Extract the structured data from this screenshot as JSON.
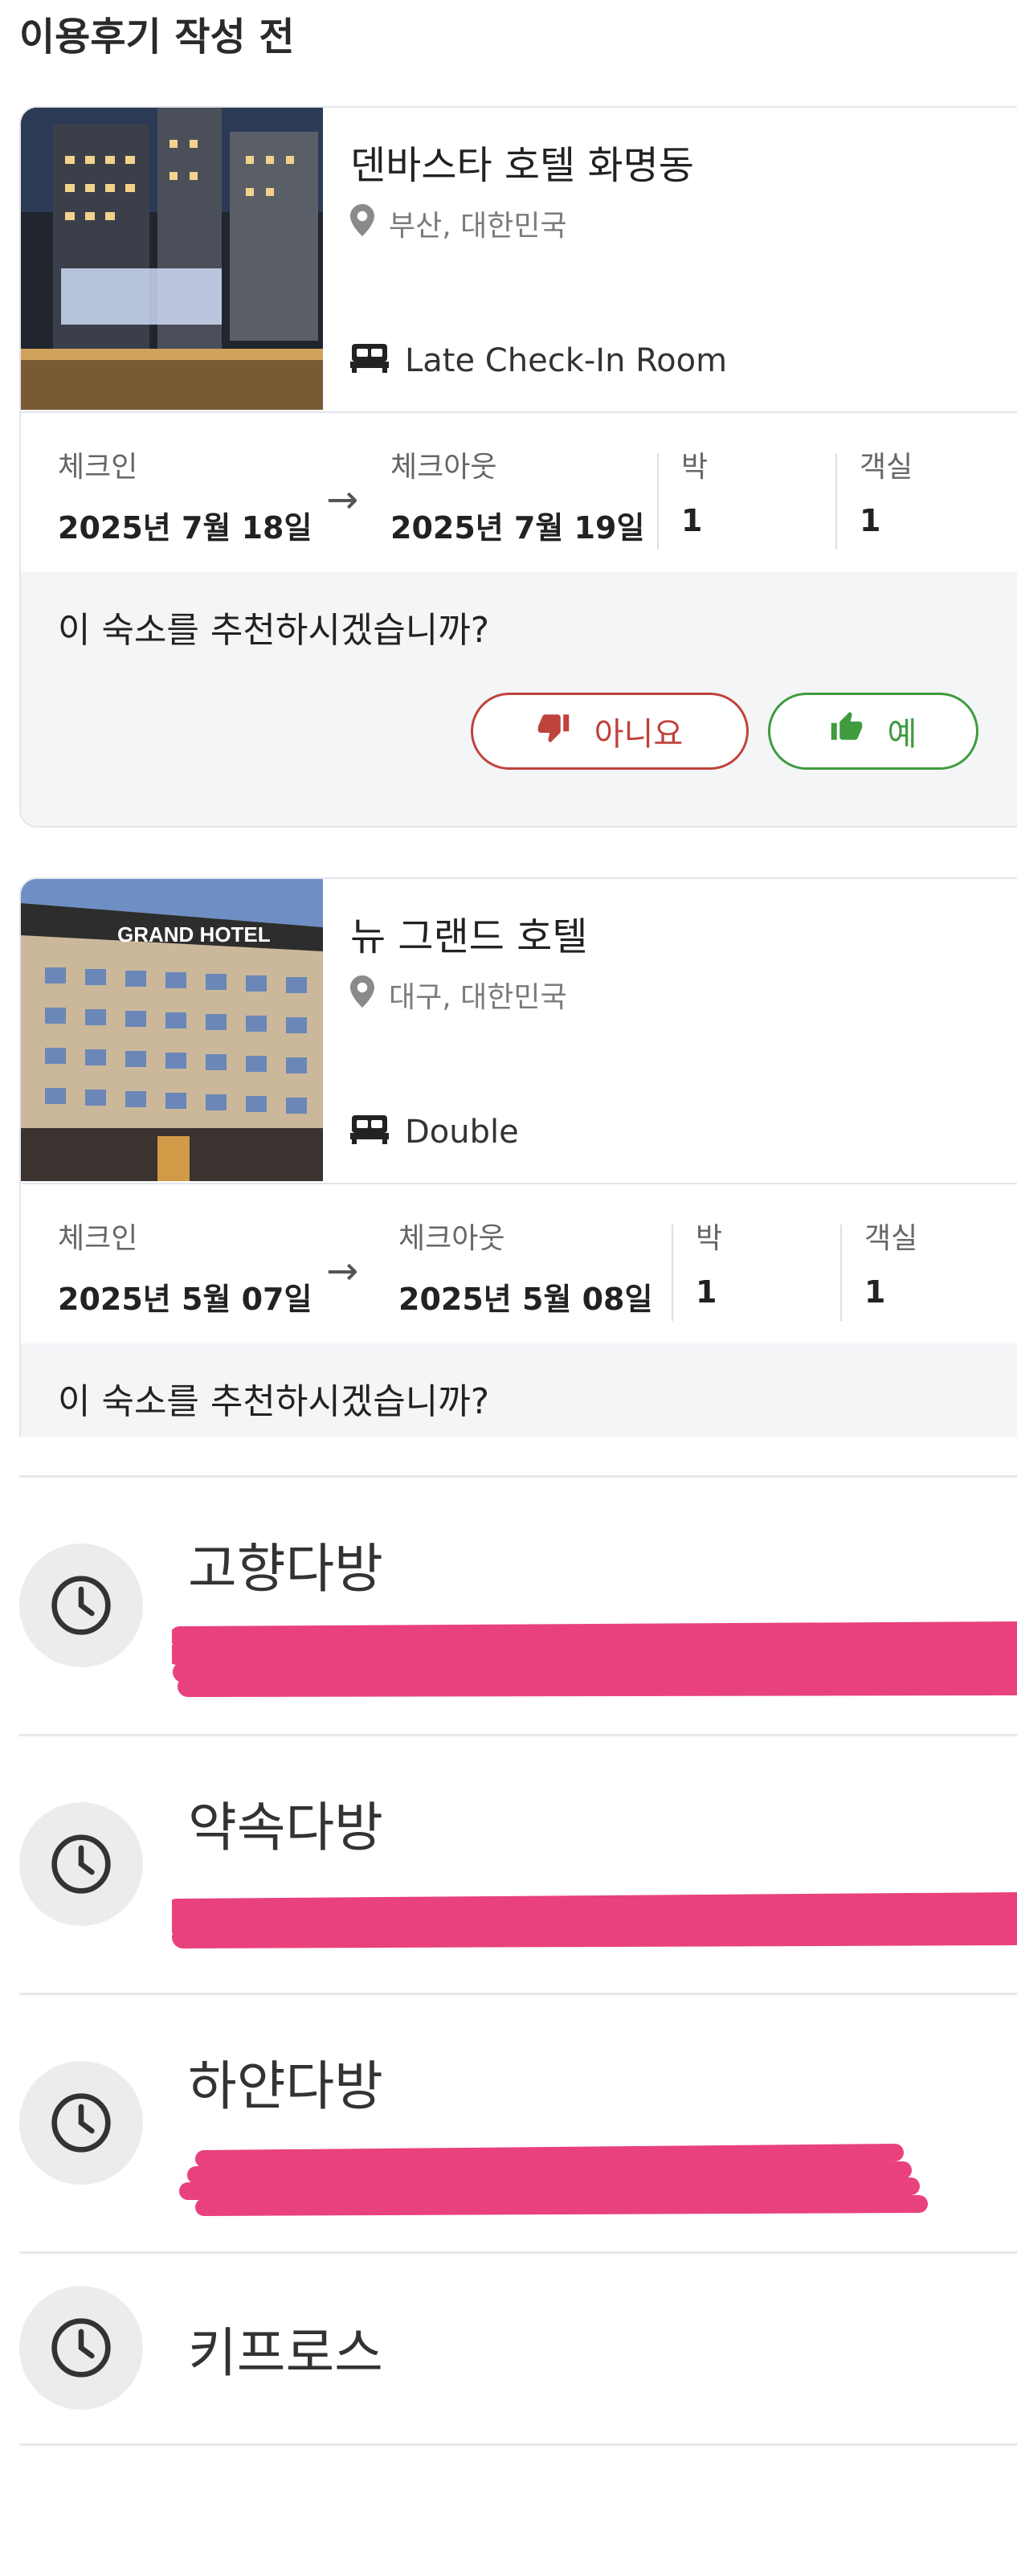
{
  "header": {
    "title": "이용후기 작성 전"
  },
  "bookings": [
    {
      "hotel_name": "덴바스타 호텔 화명동",
      "location": "부산, 대한민국",
      "room_type": "Late Check-In Room",
      "checkin_label": "체크인",
      "checkin_date": "2025년 7월 18일",
      "checkout_label": "체크아웃",
      "checkout_date": "2025년 7월 19일",
      "nights_label": "박",
      "nights": "1",
      "rooms_label": "객실",
      "rooms": "1",
      "recommend_question": "이 숙소를 추천하시겠습니까?",
      "no_label": "아니요",
      "yes_label": "예"
    },
    {
      "hotel_name": "뉴 그랜드 호텔",
      "location": "대구, 대한민국",
      "room_type": "Double",
      "checkin_label": "체크인",
      "checkin_date": "2025년 5월 07일",
      "checkout_label": "체크아웃",
      "checkout_date": "2025년 5월 08일",
      "nights_label": "박",
      "nights": "1",
      "rooms_label": "객실",
      "rooms": "1",
      "recommend_question": "이 숙소를 추천하시겠습니까?",
      "photo_sign": "GRAND HOTEL"
    }
  ],
  "recent": [
    {
      "name": "고향다방"
    },
    {
      "name": "약속다방"
    },
    {
      "name": "하얀다방"
    },
    {
      "name": "키프로스"
    }
  ],
  "colors": {
    "no": "#c0423c",
    "yes": "#3e9b3e",
    "redaction": "#e8417e"
  },
  "icons": {
    "location": "map-pin-icon",
    "room": "bed-icon",
    "no": "thumbs-down-icon",
    "yes": "thumbs-up-icon",
    "history": "clock-icon"
  }
}
